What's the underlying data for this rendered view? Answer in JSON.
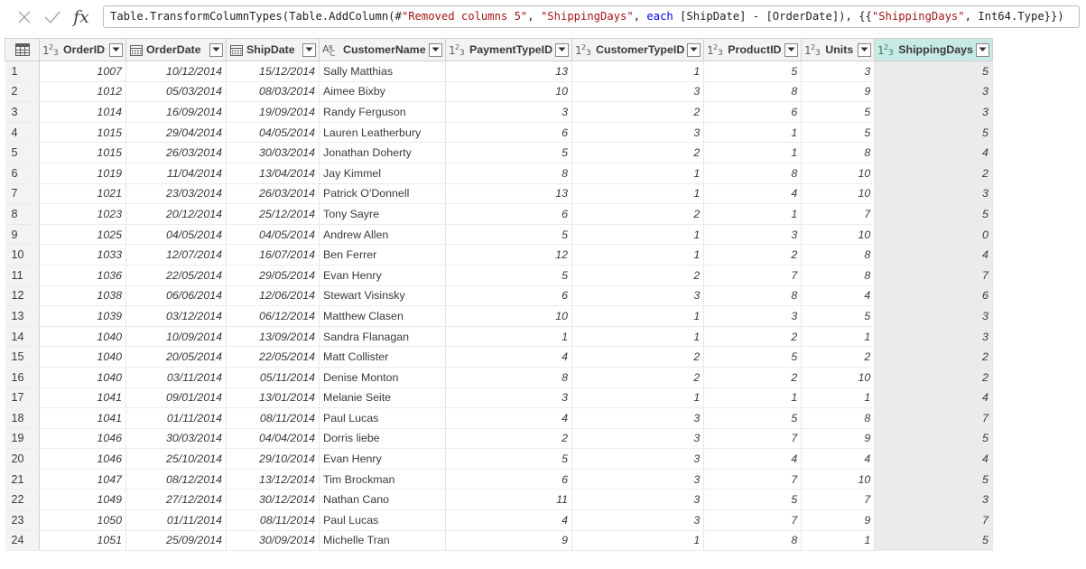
{
  "formula": {
    "prefix": "Table.TransformColumnTypes(Table.AddColumn(#",
    "step_name": "\"Removed columns 5\"",
    "sep1": ", ",
    "new_col": "\"ShippingDays\"",
    "sep2": ", ",
    "each_kw": "each",
    "expr": " [ShipDate] - [OrderDate]), {{",
    "col_ref": "\"ShippingDays\"",
    "suffix": ", Int64.Type}})"
  },
  "icons": {
    "cancel": "close-icon",
    "commit": "checkmark-icon",
    "fx": "fx",
    "table": "table-icon",
    "number_type": "number-type-icon",
    "date_type": "date-type-icon",
    "text_type": "text-type-icon",
    "filter": "chevron-down-icon"
  },
  "colors": {
    "selected_header": "#c7ebe4",
    "selected_column": "#ebebeb",
    "string_literal": "#a31515",
    "keyword": "#0000ff"
  },
  "columns": [
    {
      "name": "OrderID",
      "type": "number"
    },
    {
      "name": "OrderDate",
      "type": "date"
    },
    {
      "name": "ShipDate",
      "type": "date"
    },
    {
      "name": "CustomerName",
      "type": "text"
    },
    {
      "name": "PaymentTypeID",
      "type": "number"
    },
    {
      "name": "CustomerTypeID",
      "type": "number"
    },
    {
      "name": "ProductID",
      "type": "number"
    },
    {
      "name": "Units",
      "type": "number"
    },
    {
      "name": "ShippingDays",
      "type": "number",
      "selected": true
    }
  ],
  "rows": [
    [
      "1007",
      "10/12/2014",
      "15/12/2014",
      "Sally Matthias",
      "13",
      "1",
      "5",
      "3",
      "5"
    ],
    [
      "1012",
      "05/03/2014",
      "08/03/2014",
      "Aimee Bixby",
      "10",
      "3",
      "8",
      "9",
      "3"
    ],
    [
      "1014",
      "16/09/2014",
      "19/09/2014",
      "Randy Ferguson",
      "3",
      "2",
      "6",
      "5",
      "3"
    ],
    [
      "1015",
      "29/04/2014",
      "04/05/2014",
      "Lauren Leatherbury",
      "6",
      "3",
      "1",
      "5",
      "5"
    ],
    [
      "1015",
      "26/03/2014",
      "30/03/2014",
      "Jonathan Doherty",
      "5",
      "2",
      "1",
      "8",
      "4"
    ],
    [
      "1019",
      "11/04/2014",
      "13/04/2014",
      "Jay Kimmel",
      "8",
      "1",
      "8",
      "10",
      "2"
    ],
    [
      "1021",
      "23/03/2014",
      "26/03/2014",
      "Patrick O'Donnell",
      "13",
      "1",
      "4",
      "10",
      "3"
    ],
    [
      "1023",
      "20/12/2014",
      "25/12/2014",
      "Tony Sayre",
      "6",
      "2",
      "1",
      "7",
      "5"
    ],
    [
      "1025",
      "04/05/2014",
      "04/05/2014",
      "Andrew Allen",
      "5",
      "1",
      "3",
      "10",
      "0"
    ],
    [
      "1033",
      "12/07/2014",
      "16/07/2014",
      "Ben Ferrer",
      "12",
      "1",
      "2",
      "8",
      "4"
    ],
    [
      "1036",
      "22/05/2014",
      "29/05/2014",
      "Evan Henry",
      "5",
      "2",
      "7",
      "8",
      "7"
    ],
    [
      "1038",
      "06/06/2014",
      "12/06/2014",
      "Stewart Visinsky",
      "6",
      "3",
      "8",
      "4",
      "6"
    ],
    [
      "1039",
      "03/12/2014",
      "06/12/2014",
      "Matthew Clasen",
      "10",
      "1",
      "3",
      "5",
      "3"
    ],
    [
      "1040",
      "10/09/2014",
      "13/09/2014",
      "Sandra Flanagan",
      "1",
      "1",
      "2",
      "1",
      "3"
    ],
    [
      "1040",
      "20/05/2014",
      "22/05/2014",
      "Matt Collister",
      "4",
      "2",
      "5",
      "2",
      "2"
    ],
    [
      "1040",
      "03/11/2014",
      "05/11/2014",
      "Denise Monton",
      "8",
      "2",
      "2",
      "10",
      "2"
    ],
    [
      "1041",
      "09/01/2014",
      "13/01/2014",
      "Melanie Seite",
      "3",
      "1",
      "1",
      "1",
      "4"
    ],
    [
      "1041",
      "01/11/2014",
      "08/11/2014",
      "Paul Lucas",
      "4",
      "3",
      "5",
      "8",
      "7"
    ],
    [
      "1046",
      "30/03/2014",
      "04/04/2014",
      "Dorris liebe",
      "2",
      "3",
      "7",
      "9",
      "5"
    ],
    [
      "1046",
      "25/10/2014",
      "29/10/2014",
      "Evan Henry",
      "5",
      "3",
      "4",
      "4",
      "4"
    ],
    [
      "1047",
      "08/12/2014",
      "13/12/2014",
      "Tim Brockman",
      "6",
      "3",
      "7",
      "10",
      "5"
    ],
    [
      "1049",
      "27/12/2014",
      "30/12/2014",
      "Nathan Cano",
      "11",
      "3",
      "5",
      "7",
      "3"
    ],
    [
      "1050",
      "01/11/2014",
      "08/11/2014",
      "Paul Lucas",
      "4",
      "3",
      "7",
      "9",
      "7"
    ],
    [
      "1051",
      "25/09/2014",
      "30/09/2014",
      "Michelle Tran",
      "9",
      "1",
      "8",
      "1",
      "5"
    ]
  ]
}
